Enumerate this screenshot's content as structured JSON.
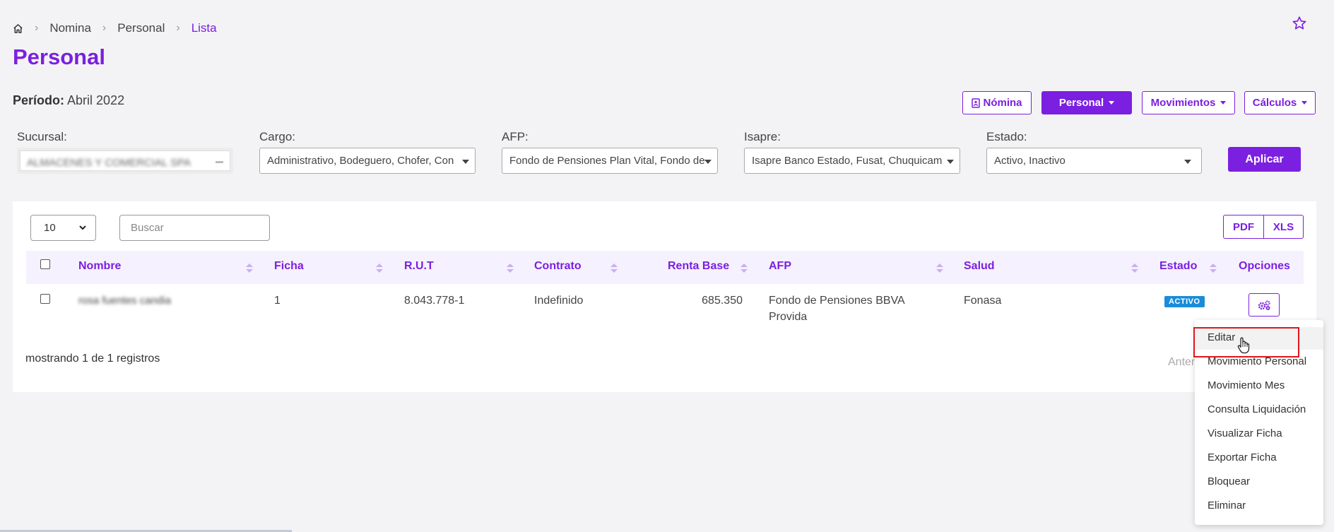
{
  "breadcrumb": {
    "items": [
      "Nomina",
      "Personal",
      "Lista"
    ]
  },
  "page": {
    "title": "Personal"
  },
  "periodo": {
    "label": "Período:",
    "value": "Abril 2022"
  },
  "topbar": {
    "nomina": "Nómina",
    "personal": "Personal",
    "movimientos": "Movimientos",
    "calculos": "Cálculos"
  },
  "filters": {
    "sucursal": {
      "label": "Sucursal:",
      "value": "ALMACENES Y COMERCIAL SPA"
    },
    "cargo": {
      "label": "Cargo:",
      "value": "Administrativo, Bodeguero, Chofer, Con"
    },
    "afp": {
      "label": "AFP:",
      "value": "Fondo de Pensiones Plan Vital, Fondo de"
    },
    "isapre": {
      "label": "Isapre:",
      "value": "Isapre Banco Estado, Fusat, Chuquicam"
    },
    "estado": {
      "label": "Estado:",
      "value": "Activo, Inactivo"
    },
    "apply": "Aplicar"
  },
  "table": {
    "length": "10",
    "search_placeholder": "Buscar",
    "export": {
      "pdf": "PDF",
      "xls": "XLS"
    },
    "columns": {
      "nombre": "Nombre",
      "ficha": "Ficha",
      "rut": "R.U.T",
      "contrato": "Contrato",
      "renta": "Renta Base",
      "afp": "AFP",
      "salud": "Salud",
      "estado": "Estado",
      "opciones": "Opciones"
    },
    "rows": [
      {
        "nombre": "rosa fuentes candia",
        "ficha": "1",
        "rut": "8.043.778-1",
        "contrato": "Indefinido",
        "renta": "685.350",
        "afp_l1": "Fondo de Pensiones BBVA",
        "afp_l2": "Provida",
        "salud": "Fonasa",
        "estado": "ACTIVO"
      }
    ],
    "info": "mostrando 1 de 1 registros",
    "prev": "Anter"
  },
  "menu": {
    "items": [
      "Editar",
      "Movimiento Personal",
      "Movimiento Mes",
      "Consulta Liquidación",
      "Visualizar Ficha",
      "Exportar Ficha",
      "Bloquear",
      "Eliminar"
    ]
  },
  "colors": {
    "accent": "#7b1fe0",
    "badge": "#1a8cd8",
    "highlight": "#e0161c"
  }
}
